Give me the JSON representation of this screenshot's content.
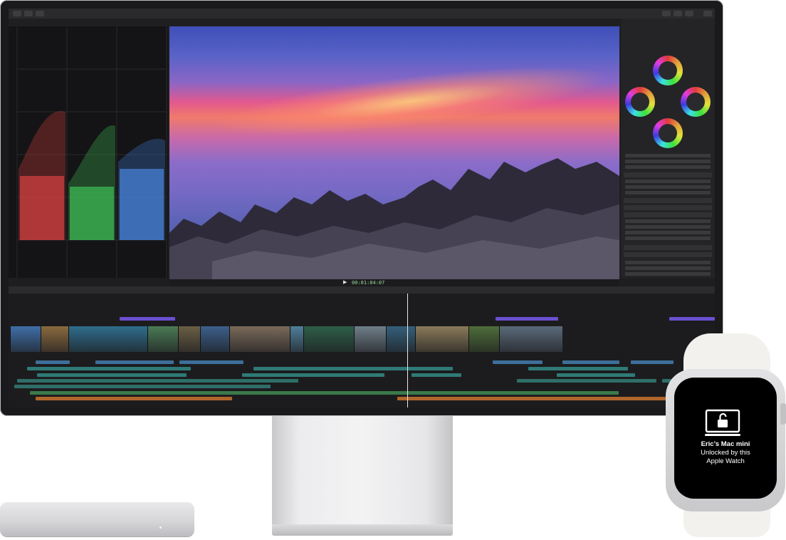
{
  "devices": {
    "watch": {
      "lock_icon": "unlocked-laptop-icon",
      "title": "Eric’s Mac mini",
      "line1": "Unlocked by this",
      "line2": "Apple Watch"
    }
  },
  "app": {
    "playhead_timecode": "00:01:04:07",
    "clips_colors": [
      "#3f6fa8",
      "#8a6a3f",
      "#2f6d8c",
      "#4b7a56",
      "#6a5f45",
      "#3c5f8a",
      "#7a6a5a",
      "#4f7f9a",
      "#2e5e4a",
      "#6f7f8a",
      "#355f7a",
      "#8a7a5a",
      "#4e6e3a",
      "#5a6a7a"
    ],
    "lane_colors": {
      "title": "#6b4fd1",
      "blue": "#3d6f9a",
      "teal": "#2f7a77",
      "green": "#3a7a4a",
      "orange": "#b0662a"
    }
  }
}
